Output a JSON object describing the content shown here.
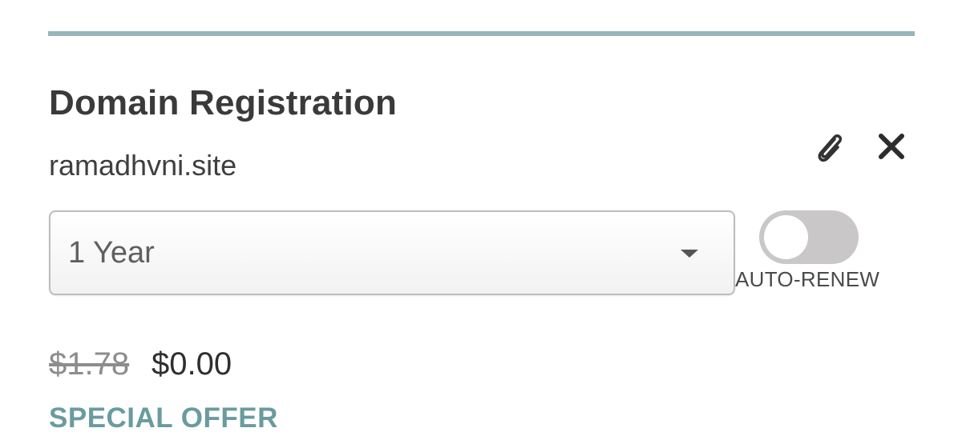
{
  "item": {
    "title": "Domain Registration",
    "domain": "ramadhvni.site"
  },
  "actions": {
    "attach_icon": "paperclip-icon",
    "remove_icon": "close-icon"
  },
  "term_select": {
    "value": "1 Year"
  },
  "auto_renew": {
    "label": "AUTO-RENEW",
    "enabled": false
  },
  "pricing": {
    "original": "$1.78",
    "current": "$0.00",
    "badge": "SPECIAL OFFER"
  },
  "colors": {
    "divider": "#97b5bb",
    "offer": "#6a9b9f",
    "toggle_off": "#c9c7c8"
  }
}
